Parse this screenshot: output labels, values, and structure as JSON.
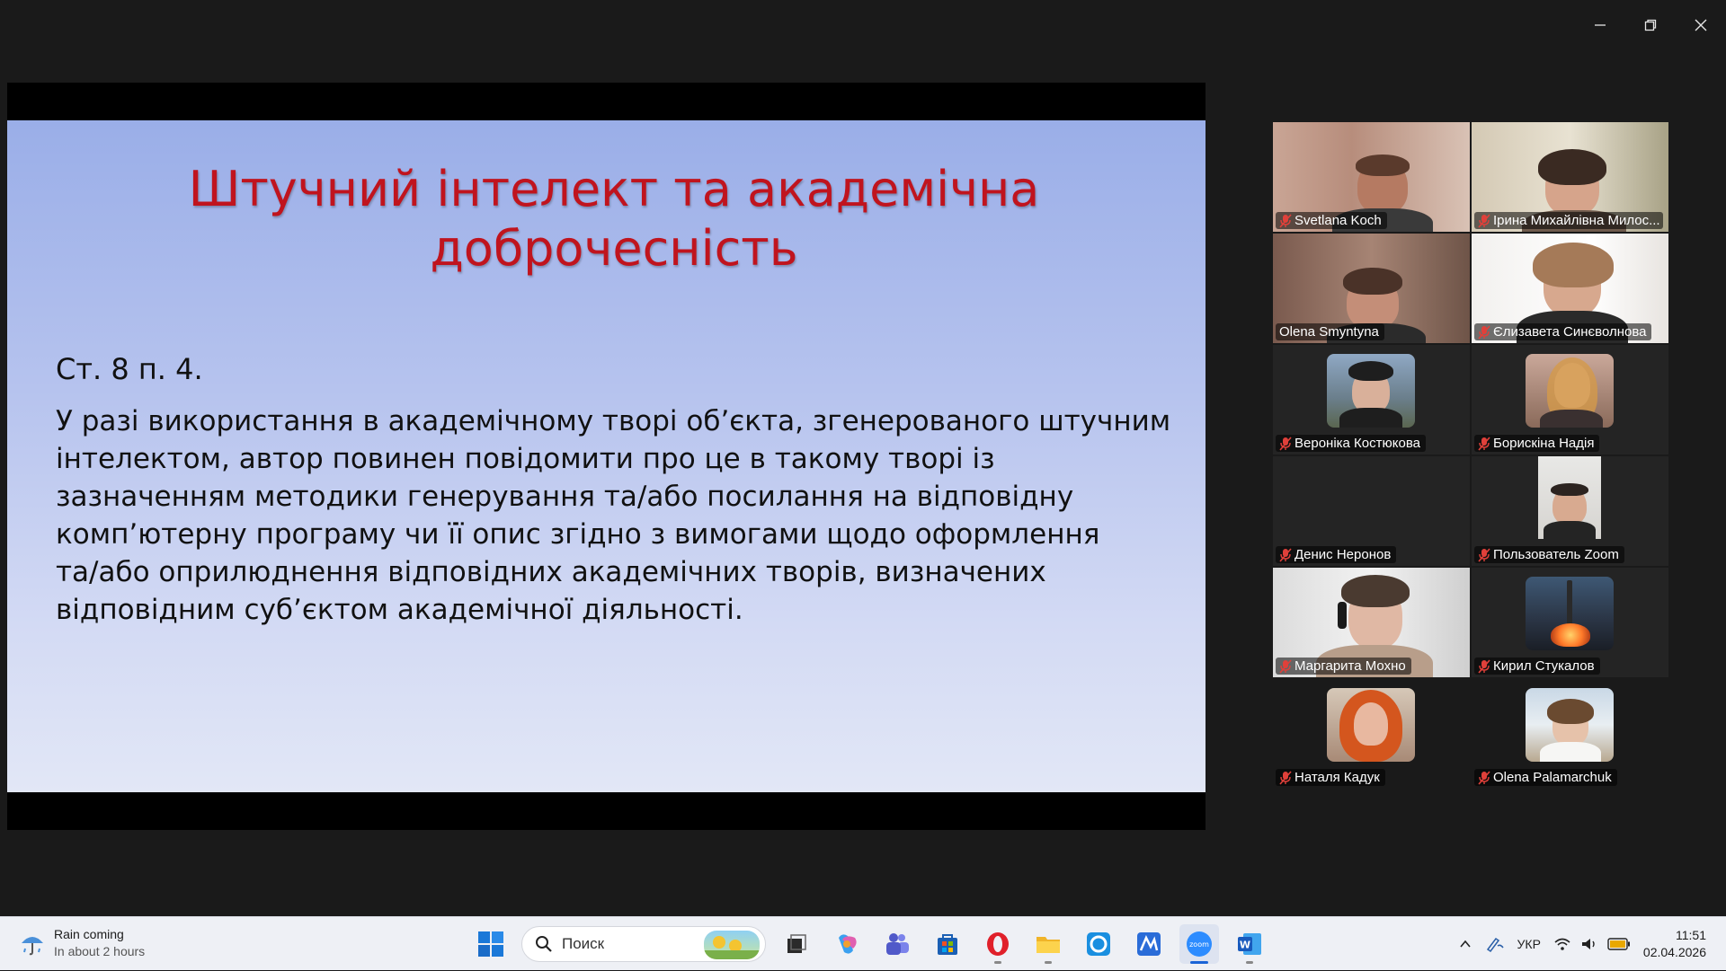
{
  "slide": {
    "title_line1": "Штучний інтелект та академічна",
    "title_line2": "доброчесність",
    "subtitle": "Ст. 8 п. 4.",
    "body_lines": [
      "У разі використання в академічному творі об’єкта, згенерованого штучним",
      "інтелектом, автор повинен повідомити про це в такому творі із",
      "зазначенням методики генерування та/або посилання на відповідну",
      "комп’ютерну програму чи її опис згідно з вимогами щодо оформлення",
      "та/або оприлюднення відповідних академічних творів, визначених",
      "відповідним суб’єктом академічної діяльності."
    ]
  },
  "participants": [
    {
      "name": "Svetlana Koch",
      "muted": true
    },
    {
      "name": "Ірина Михайлівна Милос...",
      "muted": true
    },
    {
      "name": "Olena Smyntyna",
      "muted": false,
      "speaking": true
    },
    {
      "name": "Єлизавета Синєволнова",
      "muted": true
    },
    {
      "name": "Вероніка Костюкова",
      "muted": true
    },
    {
      "name": "Борискіна Надія",
      "muted": true
    },
    {
      "name": "Денис Неронов",
      "muted": true
    },
    {
      "name": "Пользователь Zoom",
      "muted": true
    },
    {
      "name": "Маргарита Мохно",
      "muted": true
    },
    {
      "name": "Кирил Стукалов",
      "muted": true
    },
    {
      "name": "Наталя Кадук",
      "muted": true
    },
    {
      "name": "Olena Palamarchuk",
      "muted": true
    }
  ],
  "taskbar": {
    "weather_title": "Rain coming",
    "weather_sub": "In about 2 hours",
    "search_placeholder": "Поиск",
    "language": "УКР",
    "time": "11:51",
    "date": "02.04.2026"
  },
  "colors": {
    "title_red": "#c0141e",
    "active_speaker": "#23d982",
    "mic_muted": "#e0403a"
  }
}
